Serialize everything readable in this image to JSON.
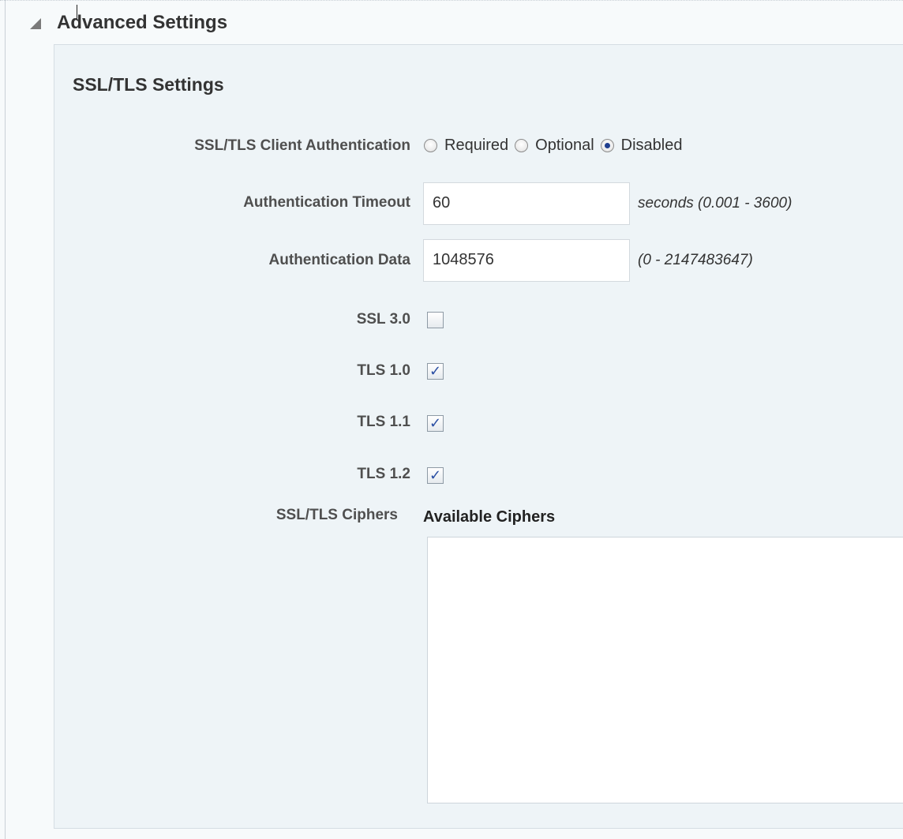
{
  "section": {
    "title": "Advanced Settings"
  },
  "panel": {
    "title": "SSL/TLS Settings"
  },
  "client_auth": {
    "label": "SSL/TLS Client Authentication",
    "options": [
      {
        "label": "Required",
        "checked": false
      },
      {
        "label": "Optional",
        "checked": false
      },
      {
        "label": "Disabled",
        "checked": true
      }
    ]
  },
  "auth_timeout": {
    "label": "Authentication Timeout",
    "value": "60",
    "hint": "seconds (0.001 - 3600)"
  },
  "auth_data": {
    "label": "Authentication Data",
    "value": "1048576",
    "hint": "(0 - 2147483647)"
  },
  "protocols": [
    {
      "label": "SSL 3.0",
      "checked": false
    },
    {
      "label": "TLS 1.0",
      "checked": true
    },
    {
      "label": "TLS 1.1",
      "checked": true
    },
    {
      "label": "TLS 1.2",
      "checked": true
    }
  ],
  "ciphers": {
    "label": "SSL/TLS Ciphers",
    "available_heading": "Available Ciphers",
    "available": []
  }
}
